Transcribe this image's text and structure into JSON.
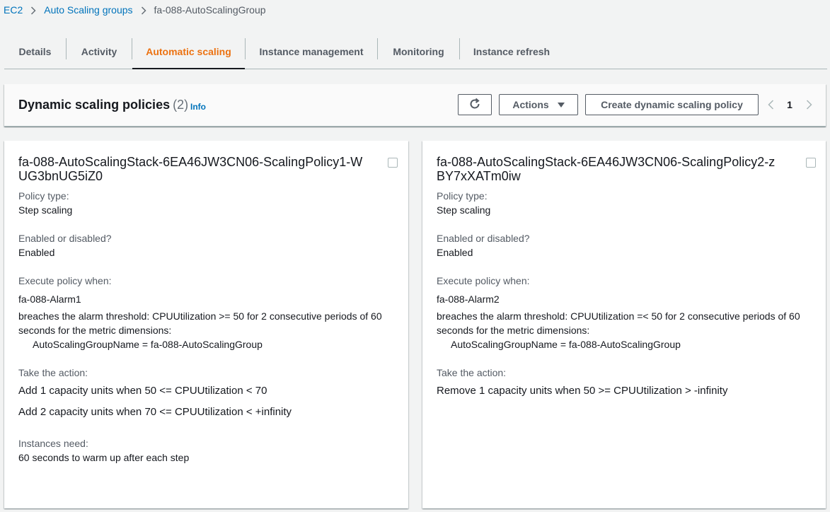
{
  "breadcrumb": {
    "items": [
      "EC2",
      "Auto Scaling groups"
    ],
    "current": "fa-088-AutoScalingGroup"
  },
  "tabs": [
    {
      "label": "Details"
    },
    {
      "label": "Activity"
    },
    {
      "label": "Automatic scaling"
    },
    {
      "label": "Instance management"
    },
    {
      "label": "Monitoring"
    },
    {
      "label": "Instance refresh"
    }
  ],
  "active_tab": "Automatic scaling",
  "header": {
    "title": "Dynamic scaling policies",
    "count": "(2)",
    "info": "Info",
    "actions_label": "Actions",
    "create_label": "Create dynamic scaling policy",
    "page": "1"
  },
  "policies": [
    {
      "name": "fa-088-AutoScalingStack-6EA46JW3CN06-ScalingPolicy1-WUG3bnUG5iZ0",
      "policy_type_label": "Policy type:",
      "policy_type": "Step scaling",
      "enabled_label": "Enabled or disabled?",
      "enabled": "Enabled",
      "execute_label": "Execute policy when:",
      "alarm": "fa-088-Alarm1",
      "breach": "breaches the alarm threshold: CPUUtilization >= 50 for 2 consecutive periods of 60 seconds for the metric dimensions:",
      "dimension": "AutoScalingGroupName = fa-088-AutoScalingGroup",
      "action_label": "Take the action:",
      "actions": [
        "Add 1 capacity units when 50 <= CPUUtilization < 70",
        "Add 2 capacity units when 70 <= CPUUtilization < +infinity"
      ],
      "warmup_label": "Instances need:",
      "warmup": "60 seconds to warm up after each step"
    },
    {
      "name": "fa-088-AutoScalingStack-6EA46JW3CN06-ScalingPolicy2-zBY7xXATm0iw",
      "policy_type_label": "Policy type:",
      "policy_type": "Step scaling",
      "enabled_label": "Enabled or disabled?",
      "enabled": "Enabled",
      "execute_label": "Execute policy when:",
      "alarm": "fa-088-Alarm2",
      "breach": "breaches the alarm threshold: CPUUtilization =< 50 for 2 consecutive periods of 60 seconds for the metric dimensions:",
      "dimension": "AutoScalingGroupName = fa-088-AutoScalingGroup",
      "action_label": "Take the action:",
      "actions": [
        "Remove 1 capacity units when 50 >= CPUUtilization > -infinity"
      ]
    }
  ],
  "colors": {
    "link": "#0073bb",
    "active_tab": "#ec7211",
    "text": "#16191f",
    "muted": "#545b64",
    "background": "#f2f3f3"
  }
}
